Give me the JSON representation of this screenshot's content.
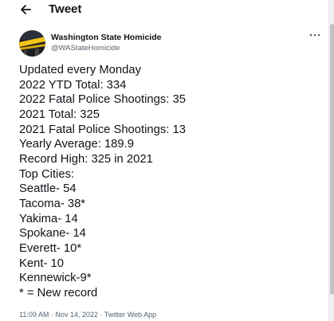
{
  "header": {
    "title": "Tweet"
  },
  "author": {
    "name": "Washington State Homicide",
    "handle": "@WAStateHomicide"
  },
  "tweet": {
    "lines": [
      "Updated every Monday",
      "2022 YTD Total: 334",
      "2022 Fatal Police Shootings: 35",
      "2021 Total: 325",
      "2021 Fatal Police Shootings: 13",
      "Yearly Average: 189.9",
      "Record High: 325 in 2021",
      "Top Cities:",
      "Seattle- 54",
      "Tacoma- 38*",
      "Yakima- 14",
      "Spokane- 14",
      "Everett- 10*",
      "Kent- 10",
      "Kennewick-9*",
      "* = New record"
    ]
  },
  "meta": {
    "time": "11:09 AM",
    "separator": "·",
    "date": "Nov 14, 2022",
    "source": "Twitter Web App"
  },
  "icons": {
    "back": "arrow-left-icon",
    "more": "more-horizontal-icon"
  },
  "colors": {
    "text_primary": "#0f1419",
    "text_secondary": "#536471",
    "background": "#ffffff",
    "avatar_tape": "#f5c518"
  }
}
